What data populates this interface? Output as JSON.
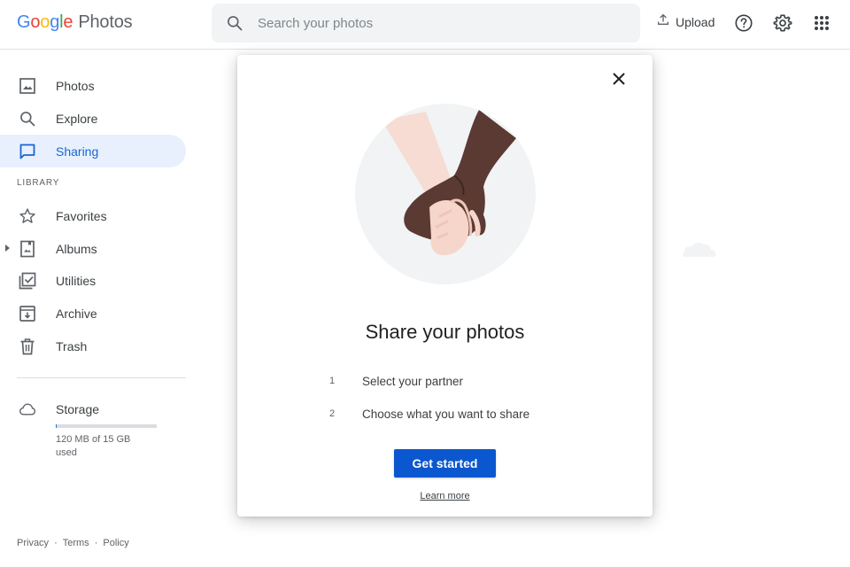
{
  "header": {
    "logo": {
      "google": [
        "G",
        "o",
        "o",
        "g",
        "l",
        "e"
      ],
      "google_colors": [
        "#4285f4",
        "#ea4335",
        "#fbbc04",
        "#4285f4",
        "#34a853",
        "#ea4335"
      ],
      "product": "Photos"
    },
    "search": {
      "placeholder": "Search your photos",
      "icon": "search-icon"
    },
    "upload_label": "Upload",
    "icons": [
      "help-icon",
      "settings-icon",
      "apps-grid-icon"
    ]
  },
  "sidebar": {
    "items": [
      {
        "label": "Photos",
        "icon": "photo-icon"
      },
      {
        "label": "Explore",
        "icon": "search-icon"
      },
      {
        "label": "Sharing",
        "icon": "chat-bubble-icon",
        "active": true
      }
    ],
    "library_label": "LIBRARY",
    "library_items": [
      {
        "label": "Favorites",
        "icon": "star-icon"
      },
      {
        "label": "Albums",
        "icon": "album-icon"
      },
      {
        "label": "Utilities",
        "icon": "utilities-icon"
      },
      {
        "label": "Archive",
        "icon": "archive-icon"
      },
      {
        "label": "Trash",
        "icon": "trash-icon"
      }
    ],
    "storage": {
      "label": "Storage",
      "used_text": "120 MB of 15 GB used",
      "used_fraction": 0.008,
      "icon": "cloud-icon"
    },
    "footer": {
      "privacy": "Privacy",
      "sep": "·",
      "terms": "Terms",
      "policy": "Policy"
    }
  },
  "modal": {
    "title": "Share your photos",
    "steps": [
      {
        "num": "1",
        "text": "Select your partner"
      },
      {
        "num": "2",
        "text": "Choose what you want to share"
      }
    ],
    "cta_label": "Get started",
    "learn_more": "Learn more",
    "accent": "#0b57d0"
  }
}
